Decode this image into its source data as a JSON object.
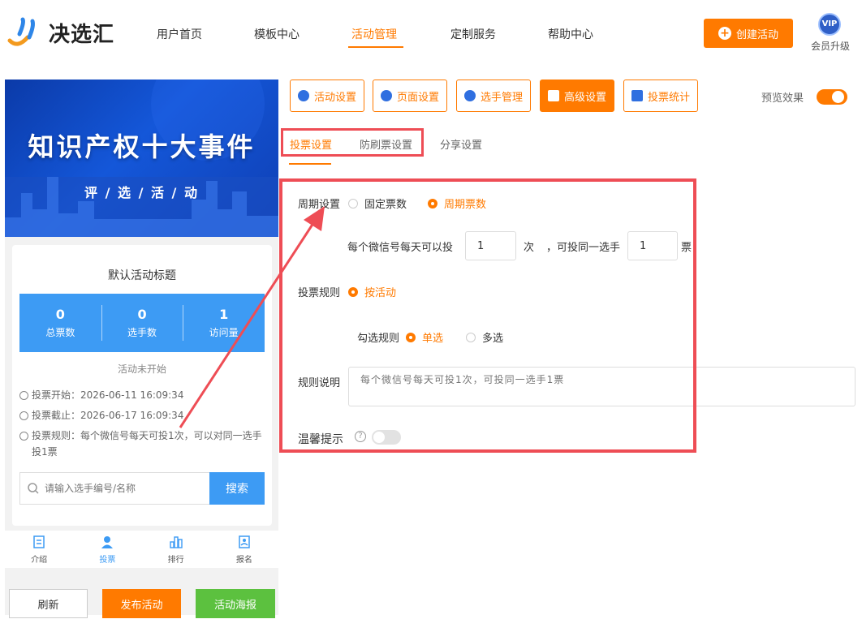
{
  "brand": {
    "name": "决选汇"
  },
  "nav": {
    "items": [
      "用户首页",
      "模板中心",
      "活动管理",
      "定制服务",
      "帮助中心"
    ]
  },
  "header": {
    "create_label": "创建活动",
    "vip_badge": "VIP",
    "vip_label": "会员升级"
  },
  "preview": {
    "banner_title": "知识产权十大事件",
    "banner_sub": "评 / 选 / 活 / 动",
    "card_title": "默认活动标题",
    "stats": [
      {
        "value": "0",
        "label": "总票数"
      },
      {
        "value": "0",
        "label": "选手数"
      },
      {
        "value": "1",
        "label": "访问量"
      }
    ],
    "status": "活动未开始",
    "vote_start": "投票开始：2026-06-11 16:09:34",
    "vote_end": "投票截止：2026-06-17 16:09:34",
    "vote_rule": "投票规则：每个微信号每天可投1次，可以对同一选手投1票",
    "search_placeholder": "请输入选手编号/名称",
    "search_label": "搜索",
    "tabbar": [
      "介绍",
      "投票",
      "排行",
      "报名"
    ]
  },
  "bottom_buttons": {
    "refresh": "刷新",
    "publish": "发布活动",
    "poster": "活动海报"
  },
  "toolbar": {
    "items": [
      "活动设置",
      "页面设置",
      "选手管理",
      "高级设置",
      "投票统计"
    ],
    "preview_label": "预览效果"
  },
  "subtabs": [
    "投票设置",
    "防刷票设置",
    "分享设置"
  ],
  "form": {
    "period_label": "周期设置",
    "period_options": [
      "固定票数",
      "周期票数"
    ],
    "daily_prefix": "每个微信号每天可以投",
    "daily_value": "1",
    "daily_unit": "次",
    "same_prefix": "，可投同一选手",
    "same_value": "1",
    "same_unit": "票",
    "rule_label": "投票规则",
    "rule_option": "按活动",
    "check_label": "勾选规则",
    "check_options": [
      "单选",
      "多选"
    ],
    "desc_label": "规则说明",
    "desc_placeholder": "每个微信号每天可投1次，可投同一选手1票",
    "tip_label": "温馨提示",
    "help_glyph": "?"
  },
  "colors": {
    "accent": "#ff7a00",
    "blue": "#3d9bf4",
    "green": "#5cc13f",
    "annotation_red": "#ee4d55"
  }
}
